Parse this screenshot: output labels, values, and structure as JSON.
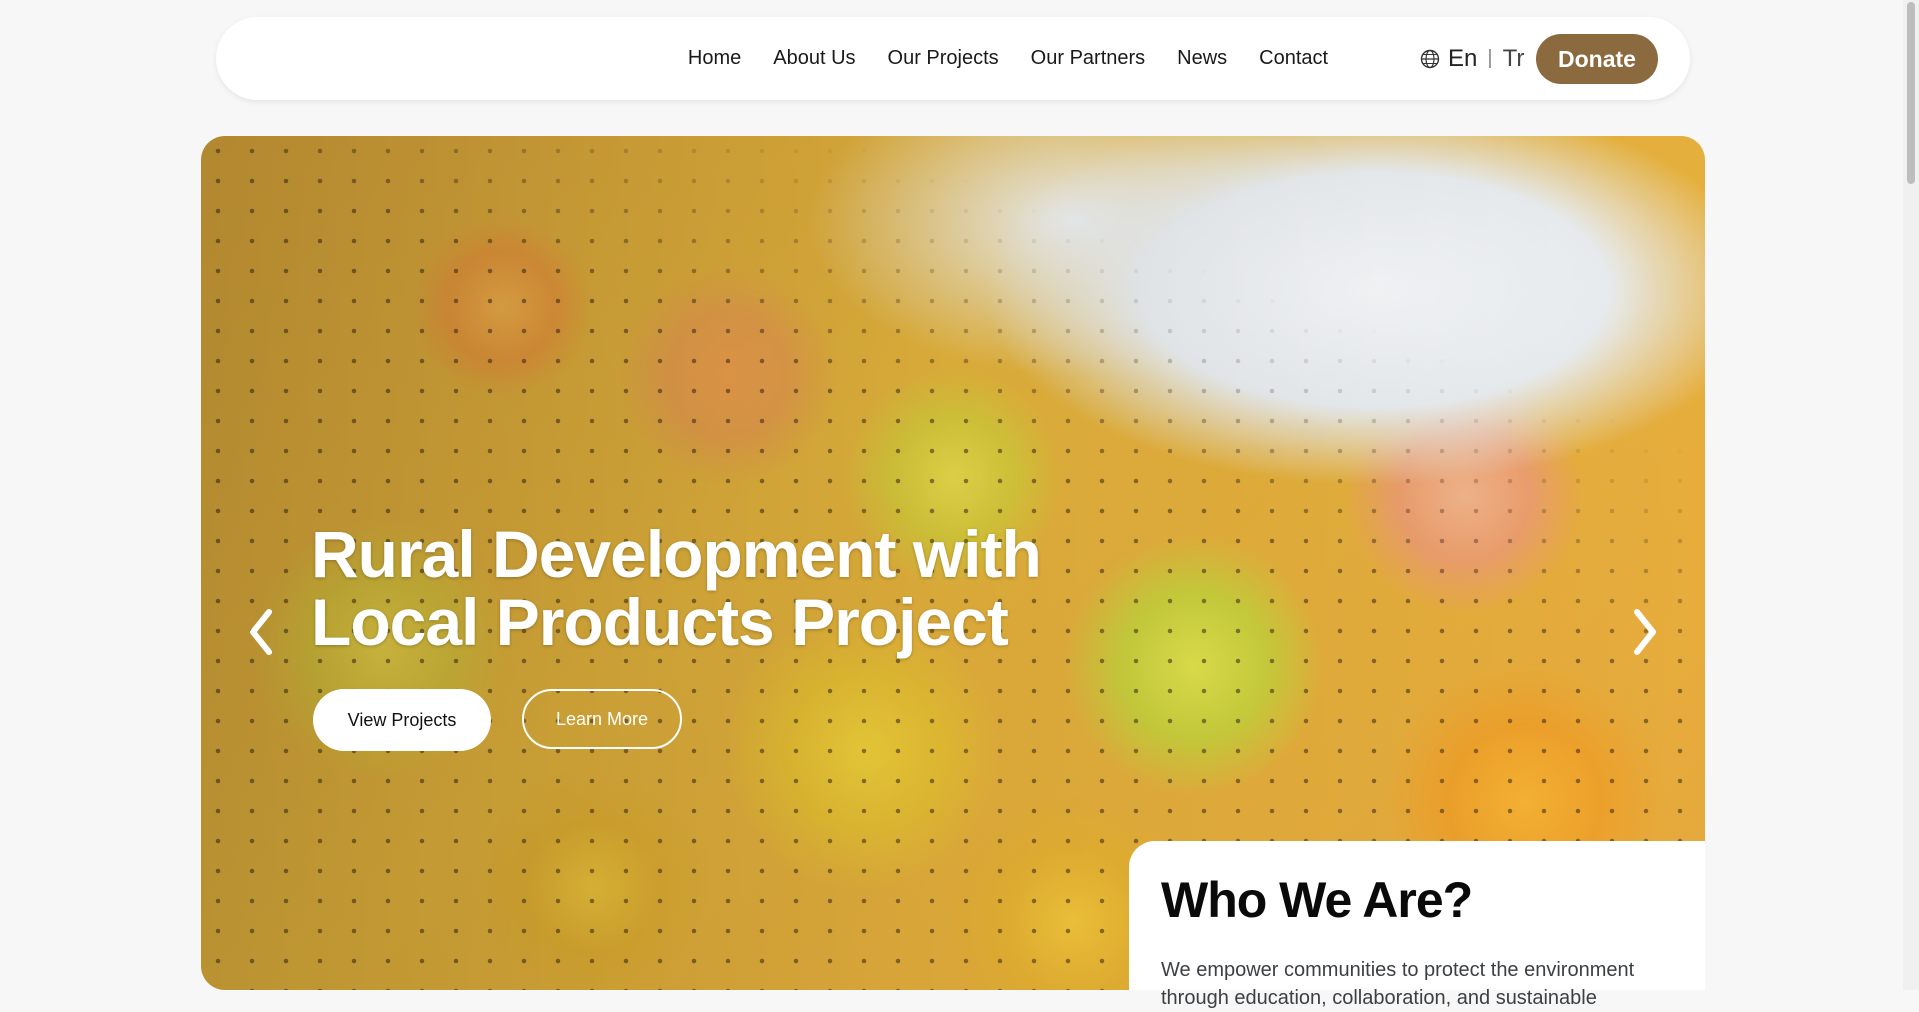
{
  "nav": {
    "links": [
      "Home",
      "About Us",
      "Our Projects",
      "Our Partners",
      "News",
      "Contact"
    ],
    "lang_current": "En",
    "lang_separator": "|",
    "lang_other": "Tr",
    "donate_label": "Donate"
  },
  "hero": {
    "title_line1": "Rural Development with",
    "title_line2": "Local Products Project",
    "view_projects_label": "View Projects",
    "learn_more_label": "Learn More"
  },
  "who": {
    "title": "Who We Are?",
    "text": "We empower communities to protect the environment through education, collaboration, and sustainable"
  },
  "colors": {
    "accent": "#8a6a3e",
    "background": "#f7f7f7"
  },
  "icons": {
    "language": "globe-icon",
    "prev": "chevron-left-icon",
    "next": "chevron-right-icon"
  }
}
